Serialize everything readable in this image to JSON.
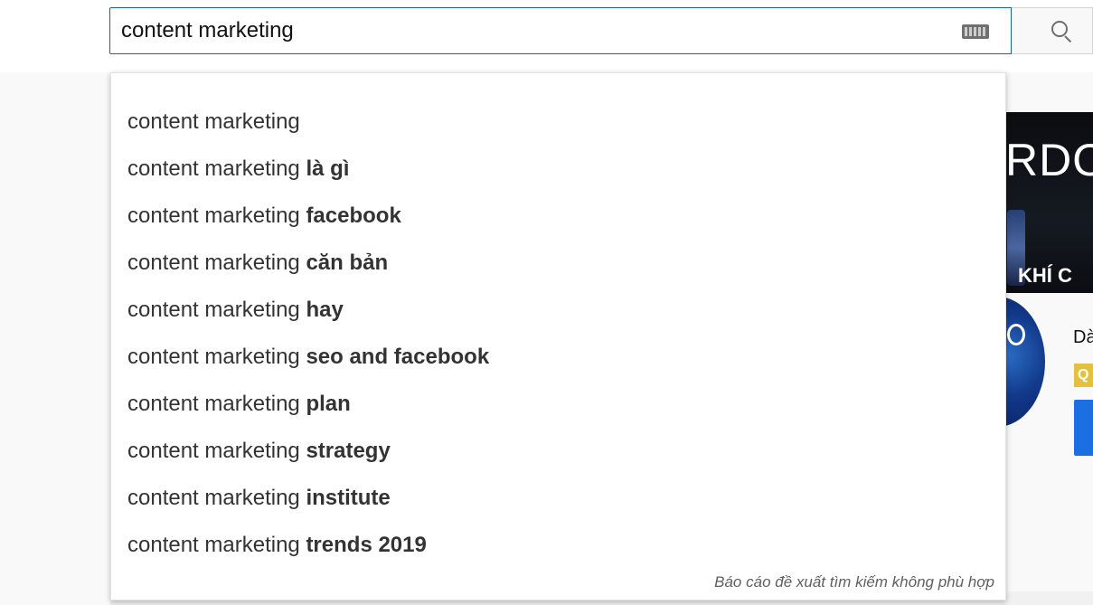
{
  "search": {
    "query": "content marketing",
    "keyboard_icon": "keyboard-icon",
    "search_icon": "search-icon"
  },
  "suggestions": [
    {
      "prefix": "content marketing",
      "suffix": ""
    },
    {
      "prefix": "content marketing ",
      "suffix": "là gì"
    },
    {
      "prefix": "content marketing ",
      "suffix": "facebook"
    },
    {
      "prefix": "content marketing ",
      "suffix": "căn bản"
    },
    {
      "prefix": "content marketing ",
      "suffix": "hay"
    },
    {
      "prefix": "content marketing ",
      "suffix": "seo and facebook"
    },
    {
      "prefix": "content marketing ",
      "suffix": "plan"
    },
    {
      "prefix": "content marketing ",
      "suffix": "strategy"
    },
    {
      "prefix": "content marketing ",
      "suffix": "institute"
    },
    {
      "prefix": "content marketing ",
      "suffix": "trends 2019"
    }
  ],
  "report_link": "Báo cáo đề xuất tìm kiếm không phù hợp",
  "background": {
    "thumbnail_title": "RDO",
    "thumbnail_subtitle": "KHÍ C",
    "channel_title": "Dà",
    "badge": "Q"
  },
  "colors": {
    "search_border": "#1c62b9",
    "button_blue": "#1b6fe0",
    "badge_yellow": "#e5c03f"
  }
}
